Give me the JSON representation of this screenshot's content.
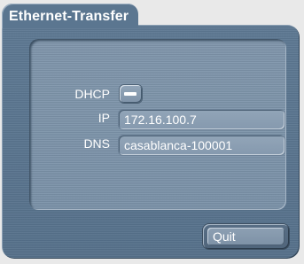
{
  "window": {
    "tab_title": "Ethernet-Transfer"
  },
  "form": {
    "dhcp": {
      "label": "DHCP",
      "icon": "minus-icon",
      "state": "off"
    },
    "ip": {
      "label": "IP",
      "value": "172.16.100.7"
    },
    "dns": {
      "label": "DNS",
      "value": "casablanca-100001"
    }
  },
  "actions": {
    "quit_label": "Quit"
  },
  "colors": {
    "window_background": "#5d7892",
    "panel_background": "#7e94aa",
    "field_background": "#8da0b3",
    "text": "#ffffff"
  }
}
